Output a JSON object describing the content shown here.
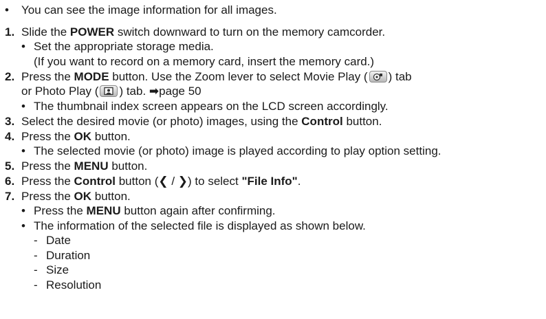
{
  "intro": "You can see the image information for all images.",
  "steps": {
    "s1": {
      "num": "1.",
      "a": "Slide the ",
      "b": "POWER",
      "c": " switch downward to turn on the memory camcorder.",
      "sub1": "Set the appropriate storage media.",
      "sub2": "(If you want to record on a memory card, insert the memory card.)"
    },
    "s2": {
      "num": "2.",
      "a": "Press the ",
      "b": "MODE",
      "c": " button. Use the Zoom lever to select Movie Play (",
      "d": ") tab",
      "e": "or Photo Play (",
      "f": ") tab. ",
      "g": "➡",
      "h": "page 50",
      "sub1": "The thumbnail index screen appears on the LCD screen accordingly."
    },
    "s3": {
      "num": "3.",
      "a": "Select the desired movie (or photo) images, using the ",
      "b": "Control",
      "c": " button."
    },
    "s4": {
      "num": "4.",
      "a": "Press the ",
      "b": "OK",
      "c": " button.",
      "sub1": "The selected movie (or photo) image is played according to play option setting."
    },
    "s5": {
      "num": "5.",
      "a": "Press the ",
      "b": "MENU",
      "c": " button."
    },
    "s6": {
      "num": "6.",
      "a": "Press the ",
      "b": "Control",
      "c": " button (",
      "left": "❮",
      "slash": " / ",
      "right": "❯",
      "d": ") to select ",
      "e": "\"File Info\"",
      "f": "."
    },
    "s7": {
      "num": "7.",
      "a": "Press the ",
      "b": "OK",
      "c": " button.",
      "sub1a": "Press the ",
      "sub1b": "MENU",
      "sub1c": " button again after confirming.",
      "sub2": "The information of the selected file is displayed as shown below.",
      "items": [
        "Date",
        "Duration",
        "Size",
        "Resolution"
      ]
    }
  },
  "bullet_char": "•",
  "dash_char": "-",
  "icons": {
    "movie_play": "movie-play-tab-icon",
    "photo_play": "photo-play-tab-icon"
  }
}
